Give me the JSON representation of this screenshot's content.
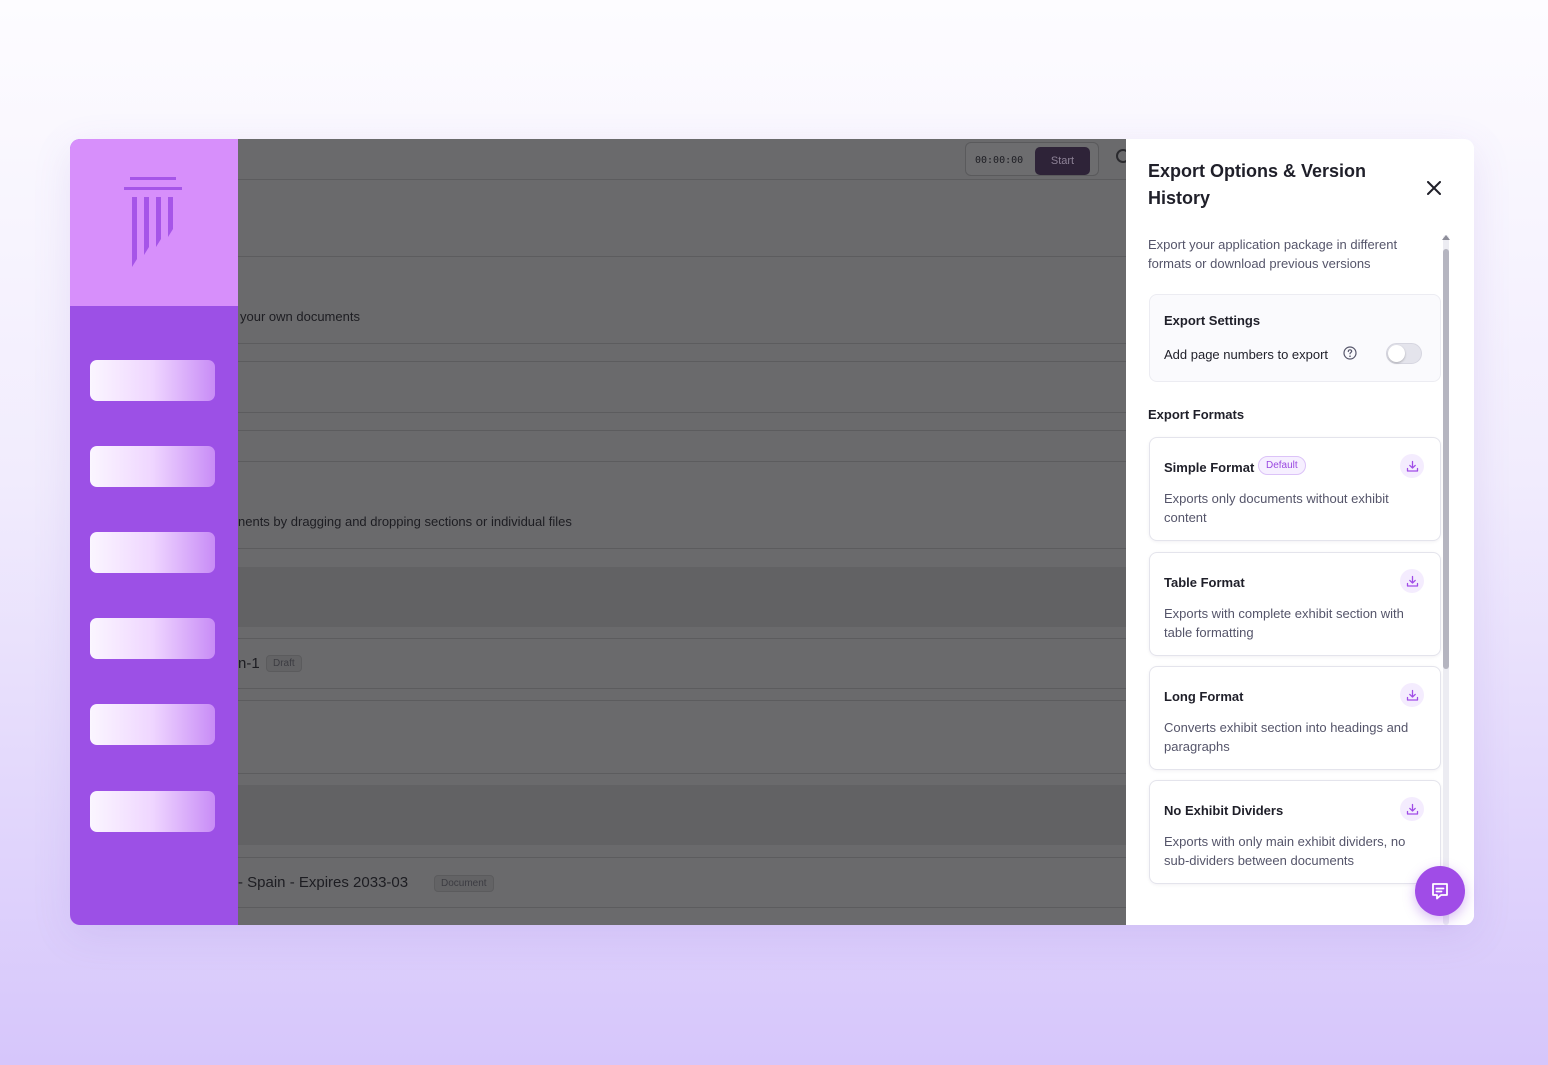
{
  "main": {
    "timer": "00:00:00",
    "start_label": "Start",
    "fragments": {
      "documents_hint": "your own documents",
      "reorder_hint": "nents by dragging and dropping sections or individual files",
      "item_title_1": "n-1",
      "item_badge_1": "Draft",
      "item_title_2": "- Spain - Expires 2033-03",
      "item_badge_2": "Document"
    }
  },
  "panel": {
    "title": "Export Options & Version History",
    "close_icon": "close-icon",
    "description": "Export your application package in different formats or download previous versions",
    "settings": {
      "title": "Export Settings",
      "page_numbers_label": "Add page numbers to export",
      "page_numbers_enabled": false
    },
    "formats_title": "Export Formats",
    "formats": [
      {
        "name": "Simple Format",
        "badge": "Default",
        "description": "Exports only documents without exhibit content"
      },
      {
        "name": "Table Format",
        "badge": "",
        "description": "Exports with complete exhibit section with table formatting"
      },
      {
        "name": "Long Format",
        "badge": "",
        "description": "Converts exhibit section into headings and paragraphs"
      },
      {
        "name": "No Exhibit Dividers",
        "badge": "",
        "description": "Exports with only main exhibit dividers, no sub-dividers between documents"
      }
    ]
  },
  "colors": {
    "accent": "#9c50e6",
    "logo_bg": "#d78ffb",
    "overlay": "#6a6a6c"
  }
}
